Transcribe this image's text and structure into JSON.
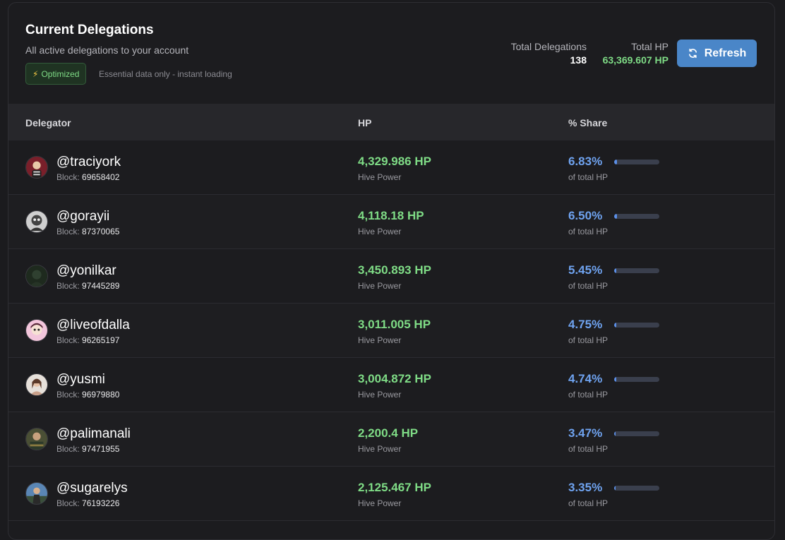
{
  "header": {
    "title": "Current Delegations",
    "subtitle": "All active delegations to your account",
    "badge_label": "Optimized",
    "badge_note": "Essential data only - instant loading",
    "total_delegations_label": "Total Delegations",
    "total_delegations_value": "138",
    "total_hp_label": "Total HP",
    "total_hp_value": "63,369.607 HP",
    "refresh_label": "Refresh"
  },
  "table": {
    "columns": [
      "Delegator",
      "HP",
      "% Share"
    ],
    "block_prefix": "Block:",
    "hp_sub": "Hive Power",
    "share_sub": "of total HP",
    "rows": [
      {
        "name": "@traciyork",
        "block": "69658402",
        "hp": "4,329.986 HP",
        "share": "6.83%",
        "share_value": 6.83,
        "avatar": "avatar-red-icon"
      },
      {
        "name": "@gorayii",
        "block": "87370065",
        "hp": "4,118.18 HP",
        "share": "6.50%",
        "share_value": 6.5,
        "avatar": "avatar-gray-icon"
      },
      {
        "name": "@yonilkar",
        "block": "97445289",
        "hp": "3,450.893 HP",
        "share": "5.45%",
        "share_value": 5.45,
        "avatar": "avatar-dark-icon"
      },
      {
        "name": "@liveofdalla",
        "block": "96265197",
        "hp": "3,011.005 HP",
        "share": "4.75%",
        "share_value": 4.75,
        "avatar": "avatar-pink-icon"
      },
      {
        "name": "@yusmi",
        "block": "96979880",
        "hp": "3,004.872 HP",
        "share": "4.74%",
        "share_value": 4.74,
        "avatar": "avatar-light-icon"
      },
      {
        "name": "@palimanali",
        "block": "97471955",
        "hp": "2,200.4 HP",
        "share": "3.47%",
        "share_value": 3.47,
        "avatar": "avatar-olive-icon"
      },
      {
        "name": "@sugarelys",
        "block": "76193226",
        "hp": "2,125.467 HP",
        "share": "3.35%",
        "share_value": 3.35,
        "avatar": "avatar-blue-icon"
      }
    ]
  },
  "colors": {
    "accent_green": "#7fdc86",
    "accent_blue": "#6fa3f0",
    "button_blue": "#4a86c8"
  }
}
